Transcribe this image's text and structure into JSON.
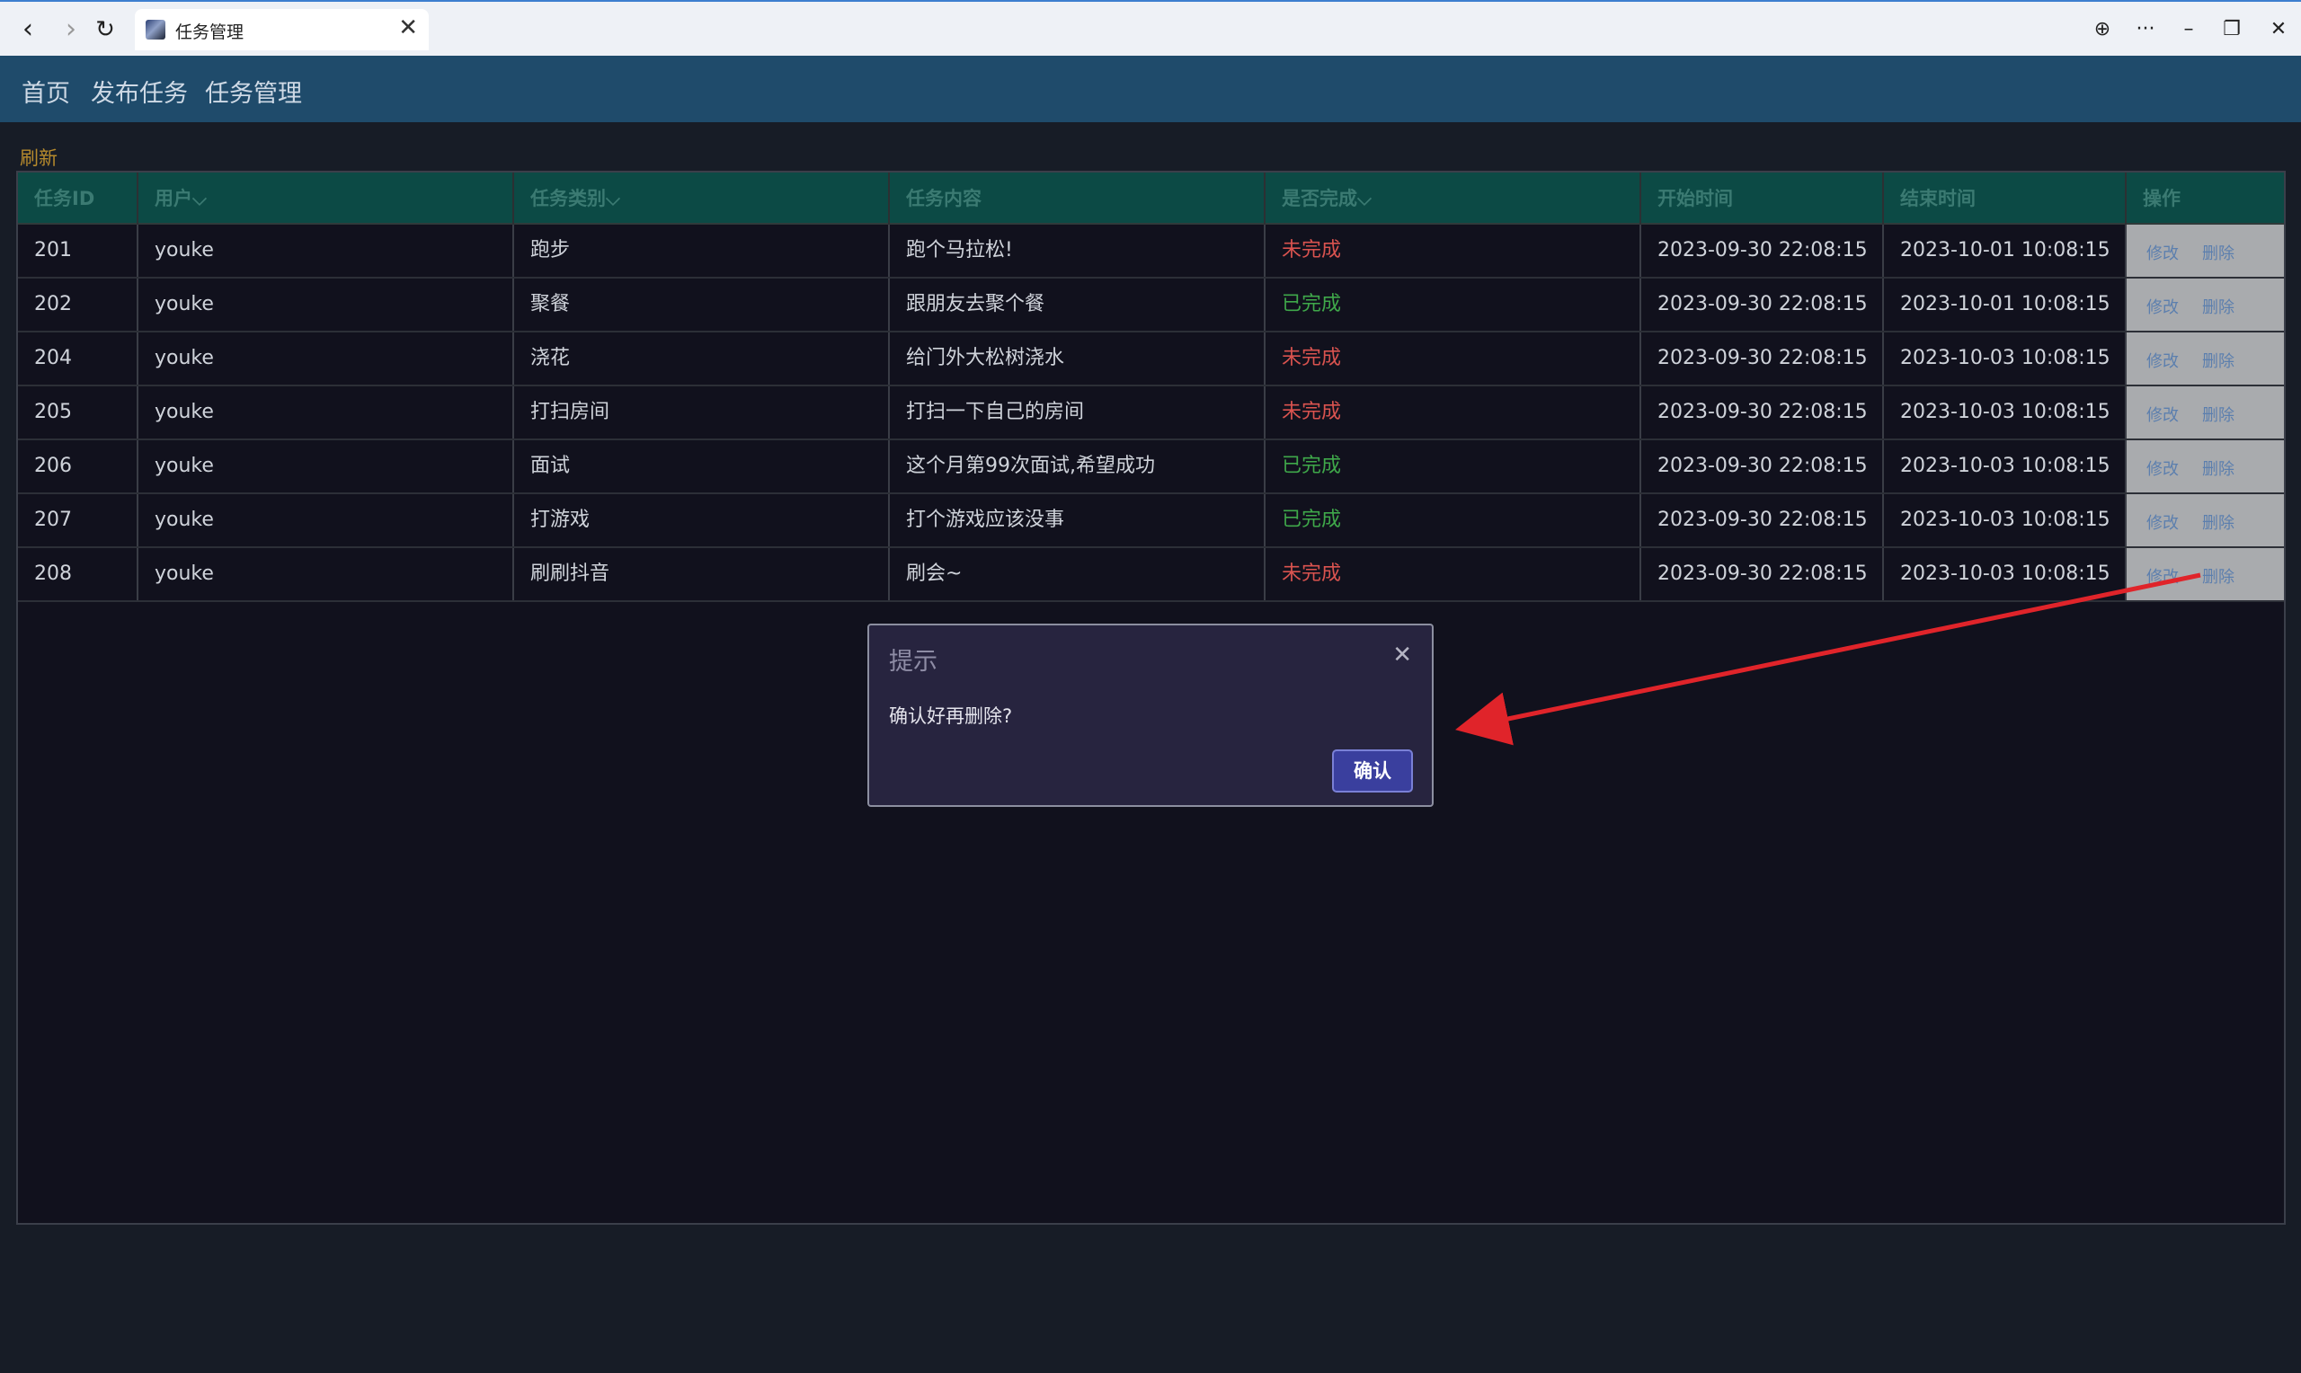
{
  "browser": {
    "tab_title": "任务管理",
    "close_glyph": "✕",
    "back_glyph": "‹",
    "forward_glyph": "›",
    "reload_glyph": "↻",
    "translate_glyph": "⊕",
    "more_glyph": "···",
    "minimize_glyph": "–",
    "restore_glyph": "❐",
    "window_close_glyph": "✕"
  },
  "nav": {
    "home": "首页",
    "publish": "发布任务",
    "manage": "任务管理"
  },
  "toolbar": {
    "refresh_label": "刷新"
  },
  "table": {
    "headers": {
      "id": "任务ID",
      "user": "用户",
      "category": "任务类别",
      "content": "任务内容",
      "status": "是否完成",
      "start": "开始时间",
      "end": "结束时间",
      "ops": "操作"
    },
    "sort_glyph": "⌵",
    "edit_label": "修改",
    "delete_label": "删除",
    "rows": [
      {
        "id": "201",
        "user": "youke",
        "category": "跑步",
        "content": "跑个马拉松!",
        "status": "未完成",
        "done": false,
        "start": "2023-09-30 22:08:15",
        "end": "2023-10-01 10:08:15"
      },
      {
        "id": "202",
        "user": "youke",
        "category": "聚餐",
        "content": "跟朋友去聚个餐",
        "status": "已完成",
        "done": true,
        "start": "2023-09-30 22:08:15",
        "end": "2023-10-01 10:08:15"
      },
      {
        "id": "204",
        "user": "youke",
        "category": "浇花",
        "content": "给门外大松树浇水",
        "status": "未完成",
        "done": false,
        "start": "2023-09-30 22:08:15",
        "end": "2023-10-03 10:08:15"
      },
      {
        "id": "205",
        "user": "youke",
        "category": "打扫房间",
        "content": "打扫一下自己的房间",
        "status": "未完成",
        "done": false,
        "start": "2023-09-30 22:08:15",
        "end": "2023-10-03 10:08:15"
      },
      {
        "id": "206",
        "user": "youke",
        "category": "面试",
        "content": "这个月第99次面试,希望成功",
        "status": "已完成",
        "done": true,
        "start": "2023-09-30 22:08:15",
        "end": "2023-10-03 10:08:15"
      },
      {
        "id": "207",
        "user": "youke",
        "category": "打游戏",
        "content": "打个游戏应该没事",
        "status": "已完成",
        "done": true,
        "start": "2023-09-30 22:08:15",
        "end": "2023-10-03 10:08:15"
      },
      {
        "id": "208",
        "user": "youke",
        "category": "刷刷抖音",
        "content": "刷会~",
        "status": "未完成",
        "done": false,
        "start": "2023-09-30 22:08:15",
        "end": "2023-10-03 10:08:15"
      }
    ]
  },
  "dialog": {
    "title": "提示",
    "message": "确认好再删除?",
    "confirm_label": "确认",
    "close_glyph": "✕"
  },
  "colors": {
    "done": "#3fa84a",
    "undone": "#d9534f",
    "annotation_arrow": "#e0242a"
  }
}
